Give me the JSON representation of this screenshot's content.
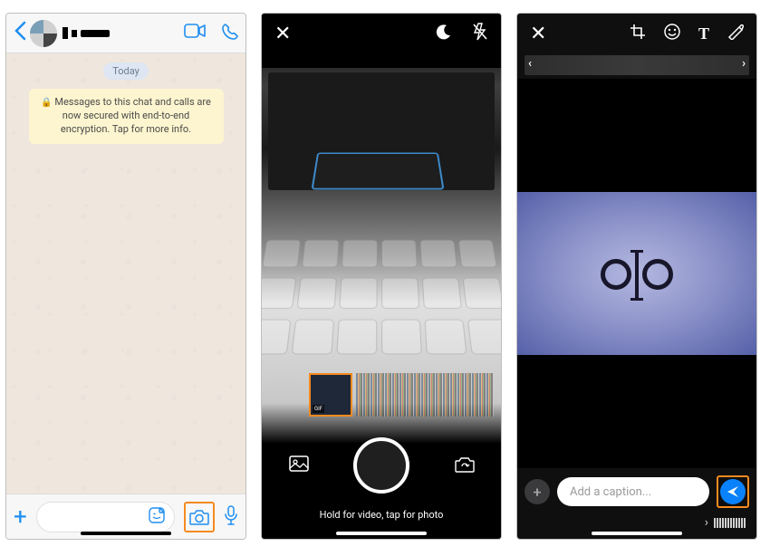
{
  "colors": {
    "accent_blue": "#1e8ef0",
    "highlight_orange": "#f58a1f",
    "send_blue": "#0a82fb"
  },
  "screen1": {
    "today_label": "Today",
    "encryption_notice": "Messages to this chat and calls are now secured with end-to-end encryption. Tap for more info.",
    "lock_glyph": "🔒"
  },
  "screen2": {
    "hint": "Hold for video, tap for photo",
    "thumb_badge": "GIF"
  },
  "screen3": {
    "caption_placeholder": "Add a caption..."
  }
}
